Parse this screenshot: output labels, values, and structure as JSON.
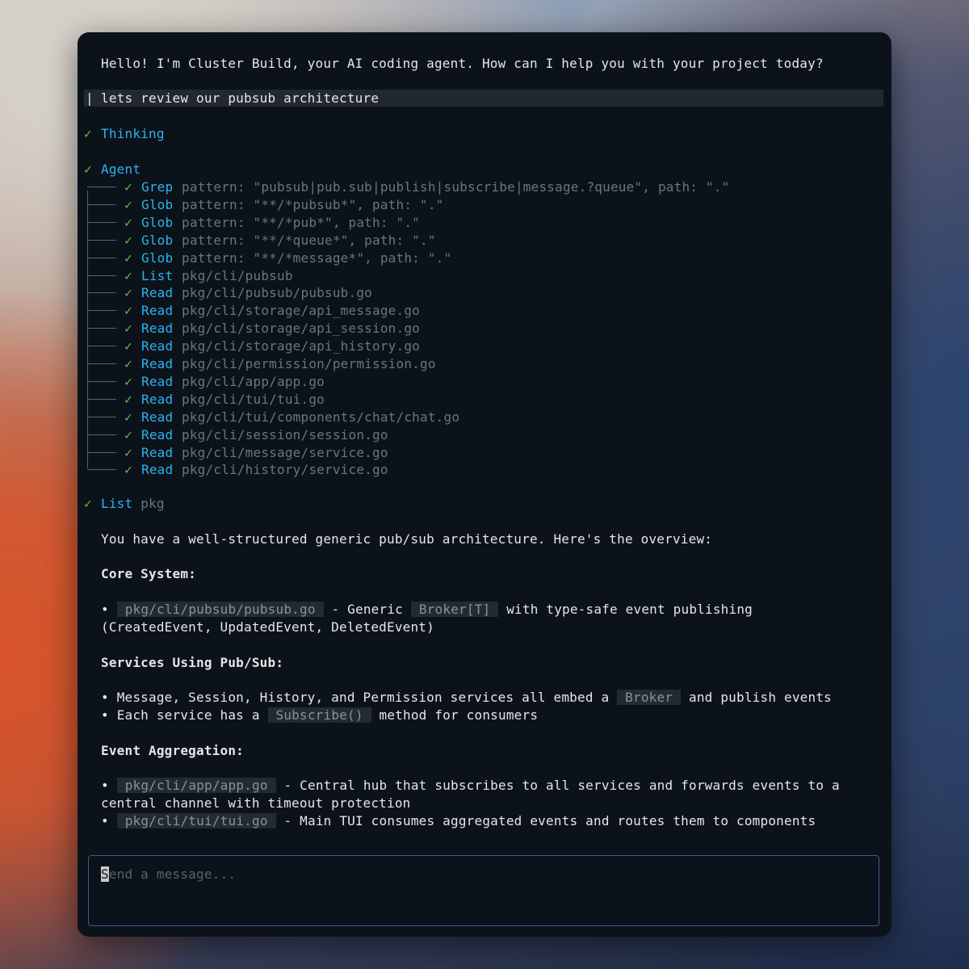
{
  "greeting": "Hello! I'm Cluster Build, your AI coding agent. How can I help you with your project today?",
  "user_message": "lets review our pubsub architecture",
  "thinking_label": "Thinking",
  "agent_label": "Agent",
  "check_glyph": "✓",
  "tools": [
    {
      "tool": "Grep",
      "args": "pattern: \"pubsub|pub.sub|publish|subscribe|message.?queue\", path: \".\""
    },
    {
      "tool": "Glob",
      "args": "pattern: \"**/*pubsub*\", path: \".\""
    },
    {
      "tool": "Glob",
      "args": "pattern: \"**/*pub*\", path: \".\""
    },
    {
      "tool": "Glob",
      "args": "pattern: \"**/*queue*\", path: \".\""
    },
    {
      "tool": "Glob",
      "args": "pattern: \"**/*message*\", path: \".\""
    },
    {
      "tool": "List",
      "args": "pkg/cli/pubsub"
    },
    {
      "tool": "Read",
      "args": "pkg/cli/pubsub/pubsub.go"
    },
    {
      "tool": "Read",
      "args": "pkg/cli/storage/api_message.go"
    },
    {
      "tool": "Read",
      "args": "pkg/cli/storage/api_session.go"
    },
    {
      "tool": "Read",
      "args": "pkg/cli/storage/api_history.go"
    },
    {
      "tool": "Read",
      "args": "pkg/cli/permission/permission.go"
    },
    {
      "tool": "Read",
      "args": "pkg/cli/app/app.go"
    },
    {
      "tool": "Read",
      "args": "pkg/cli/tui/tui.go"
    },
    {
      "tool": "Read",
      "args": "pkg/cli/tui/components/chat/chat.go"
    },
    {
      "tool": "Read",
      "args": "pkg/cli/session/session.go"
    },
    {
      "tool": "Read",
      "args": "pkg/cli/message/service.go"
    },
    {
      "tool": "Read",
      "args": "pkg/cli/history/service.go"
    }
  ],
  "list_step": {
    "tool": "List",
    "args": "pkg"
  },
  "response": {
    "intro": "You have a well-structured generic pub/sub architecture. Here's the overview:",
    "core_heading": "Core System:",
    "core_bullet": {
      "bullet": "•",
      "code": "pkg/cli/pubsub/pubsub.go",
      "text1": " - Generic ",
      "code2": "Broker[T]",
      "text2": " with type-safe event publishing",
      "cont": "(CreatedEvent, UpdatedEvent, DeletedEvent)"
    },
    "services_heading": "Services Using Pub/Sub:",
    "services_bullet1": {
      "text1": "Message, Session, History, and Permission services all embed a ",
      "code": "Broker",
      "text2": " and publish events"
    },
    "services_bullet2": {
      "text1": "Each service has a ",
      "code": "Subscribe()",
      "text2": " method for consumers"
    },
    "aggregation_heading": "Event Aggregation:",
    "agg_bullet1": {
      "code": "pkg/cli/app/app.go",
      "text": " - Central hub that subscribes to all services and forwards events to a",
      "cont": "central channel with timeout protection"
    },
    "agg_bullet2": {
      "code": "pkg/cli/tui/tui.go",
      "text": " - Main TUI consumes aggregated events and routes them to components"
    }
  },
  "input": {
    "placeholder_first": "S",
    "placeholder_rest": "end a message..."
  }
}
